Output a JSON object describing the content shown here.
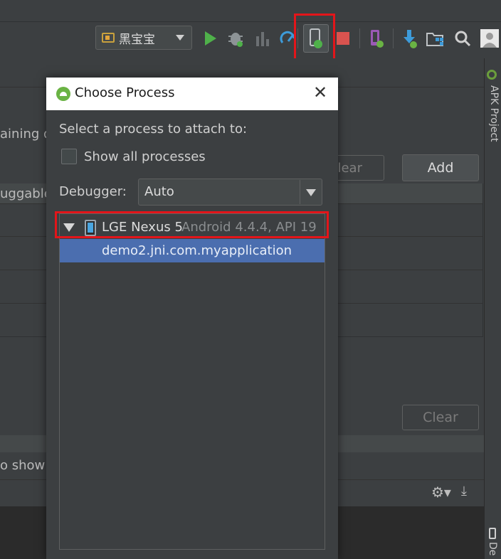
{
  "toolbar": {
    "run_config": "黑宝宝",
    "buttons": [
      "run-icon",
      "debug-icon",
      "profile-icon",
      "apply-changes-icon",
      "attach-debugger-icon",
      "stop-icon",
      "avd-manager-icon",
      "sdk-manager-icon",
      "project-structure-icon",
      "search-icon",
      "user-icon"
    ],
    "highlight_color": "#e3151a"
  },
  "right_strip": {
    "apk_project_label": "APK Project",
    "device_label": "De"
  },
  "background": {
    "training_text": "aining d",
    "clear_button_top": "lear",
    "add_button": "Add",
    "debuggable_column": "uggable",
    "clear_button": "Clear",
    "nothing_text": "o show"
  },
  "dialog": {
    "title": "Choose Process",
    "select_label": "Select a process to attach to:",
    "show_all_label": "Show all processes",
    "show_all_checked": false,
    "debugger_label": "Debugger:",
    "debugger_value": "Auto",
    "device": {
      "name": "LGE Nexus 5",
      "details": "Android 4.4.4, API 19"
    },
    "processes": [
      "demo2.jni.com.myapplication"
    ],
    "selected_color": "#4b6eaf"
  }
}
